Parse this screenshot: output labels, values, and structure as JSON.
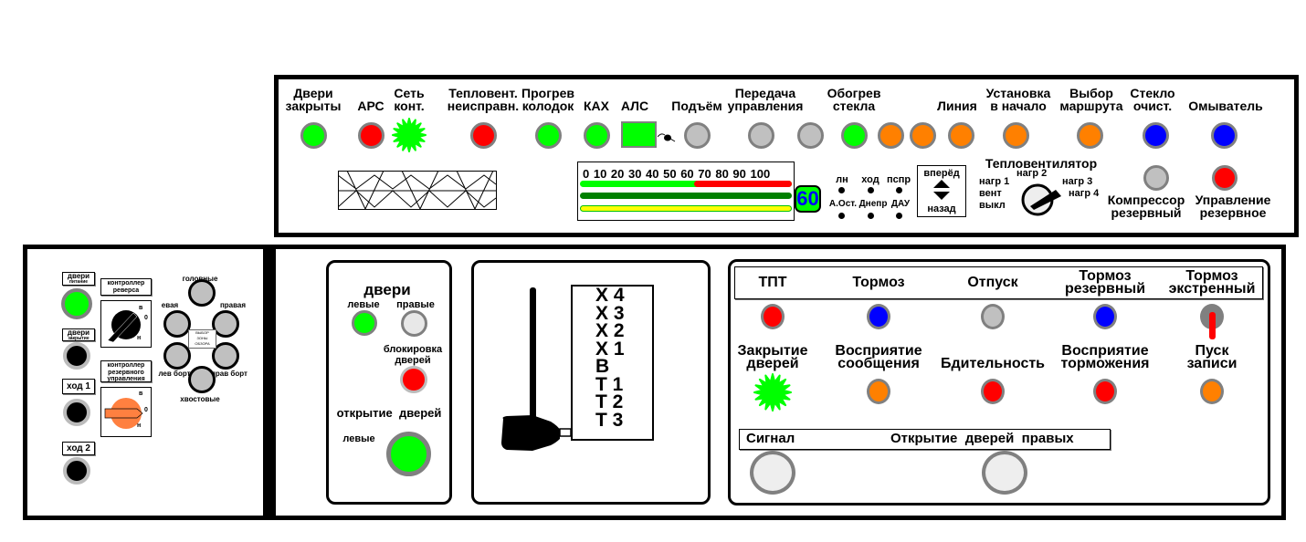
{
  "top_panel": {
    "labels": [
      "Двери\nзакрыты",
      "АРС",
      "Сеть\nконт.",
      "Тепловент.\nнеисправн.",
      "Прогрев\nколодок",
      "КАХ",
      "АЛС",
      "Подъём",
      "Передача\nуправления",
      "Обогрев\nстекла",
      "Линия",
      "Установка\nв начало",
      "Выбор\nмаршрута",
      "Стекло\nочист.",
      "Омыватель"
    ],
    "lamps": [
      {
        "name": "dveri-zakryty",
        "color": "#00ff00"
      },
      {
        "name": "ars",
        "color": "#ff0000"
      },
      {
        "name": "set-kont",
        "color": "#00ff00",
        "shape": "star"
      },
      {
        "name": "teplovent",
        "color": "#ff0000"
      },
      {
        "name": "progrev",
        "color": "#00ff00"
      },
      {
        "name": "kah",
        "color": "#00ff00"
      },
      {
        "name": "als",
        "color": "#00ff00",
        "shape": "rect"
      },
      {
        "name": "podyem",
        "color": "#c0c0c0"
      },
      {
        "name": "peredacha-1",
        "color": "#c0c0c0"
      },
      {
        "name": "peredacha-2",
        "color": "#c0c0c0"
      },
      {
        "name": "obogrev",
        "color": "#00ff00"
      },
      {
        "name": "obogrev-2",
        "color": "#ff8000"
      },
      {
        "name": "obogrev-3",
        "color": "#ff8000"
      },
      {
        "name": "liniya",
        "color": "#ff8000"
      },
      {
        "name": "ustanovka",
        "color": "#ff8000"
      },
      {
        "name": "vybor",
        "color": "#ff8000"
      },
      {
        "name": "steklo",
        "color": "#0000ff"
      },
      {
        "name": "omyvatel",
        "color": "#0000ff"
      }
    ],
    "speed": {
      "scale": "0 10 20 30 40 50 60 70 80 90 100",
      "value": "60",
      "green_bar_value": 60,
      "red_bar_from": 60,
      "red_bar_to": 100
    },
    "indicators_top": [
      "лн",
      "ход",
      "пспр"
    ],
    "indicators_bottom": [
      "А.Ост.",
      "Днепр",
      "ДАУ"
    ],
    "direction": {
      "forward": "вперёд",
      "back": "назад"
    },
    "heater": {
      "title": "Тепловентилятор",
      "positions": [
        "нагр 1",
        "нагр 2",
        "нагр 3",
        "нагр 4",
        "вент",
        "выкл"
      ]
    },
    "compressor": {
      "label": "Компрессор\nрезервный",
      "color": "#c0c0c0"
    },
    "reserve_control": {
      "label": "Управление\nрезервное",
      "color": "#ff0000"
    }
  },
  "left_panel": {
    "doors_power": {
      "title": "двери",
      "sub": "питание",
      "color": "#00ff00"
    },
    "doors_close": {
      "title": "двери",
      "sub": "закрытие"
    },
    "hod1": "ход 1",
    "hod2": "ход 2",
    "reverse": {
      "title": "контроллер\nреверса",
      "marks": [
        "в",
        "0",
        "н"
      ]
    },
    "reserve_ctrl": {
      "title": "контроллер\nрезервного\nуправления",
      "marks": [
        "в",
        "0",
        "н"
      ]
    },
    "zones": {
      "center": "ВЫБОР\nЗОНЫ\nОБЗОРА",
      "labels": [
        "головные",
        "евая",
        "правая",
        "лев борт",
        "прав борт",
        "хвостовые"
      ]
    }
  },
  "doors_panel": {
    "title": "двери",
    "left": "левые",
    "right": "правые",
    "left_color": "#00ff00",
    "right_color": "#e8e8e8",
    "lock": "блокировка\nдверей",
    "lock_color": "#ff0000",
    "open": "открытие  дверей",
    "open_left": "левые",
    "open_color": "#00ff00"
  },
  "controller": {
    "positions": [
      "Х 4",
      "Х 3",
      "Х 2",
      "Х 1",
      "В",
      "Т 1",
      "Т 2",
      "Т 3"
    ],
    "current": "Т 3"
  },
  "brake_panel": {
    "headers": [
      "ТПТ",
      "Тормоз",
      "Отпуск",
      "Тормоз\nрезервный",
      "Тормоз\nэкстренный"
    ],
    "row1": [
      "#ff0000",
      "#0000ff",
      "#c0c0c0",
      "#0000ff",
      "#808080"
    ],
    "labels2": [
      "Закрытие\nдверей",
      "Восприятие\nсообщения",
      "Бдительность",
      "Восприятие\nторможения",
      "Пуск\nзаписи"
    ],
    "row2": [
      "#00ff00",
      "#ff8000",
      "#ff0000",
      "#ff0000",
      "#ff8000"
    ],
    "signal": "Сигнал",
    "open_right": "Открытие  дверей  правых"
  }
}
